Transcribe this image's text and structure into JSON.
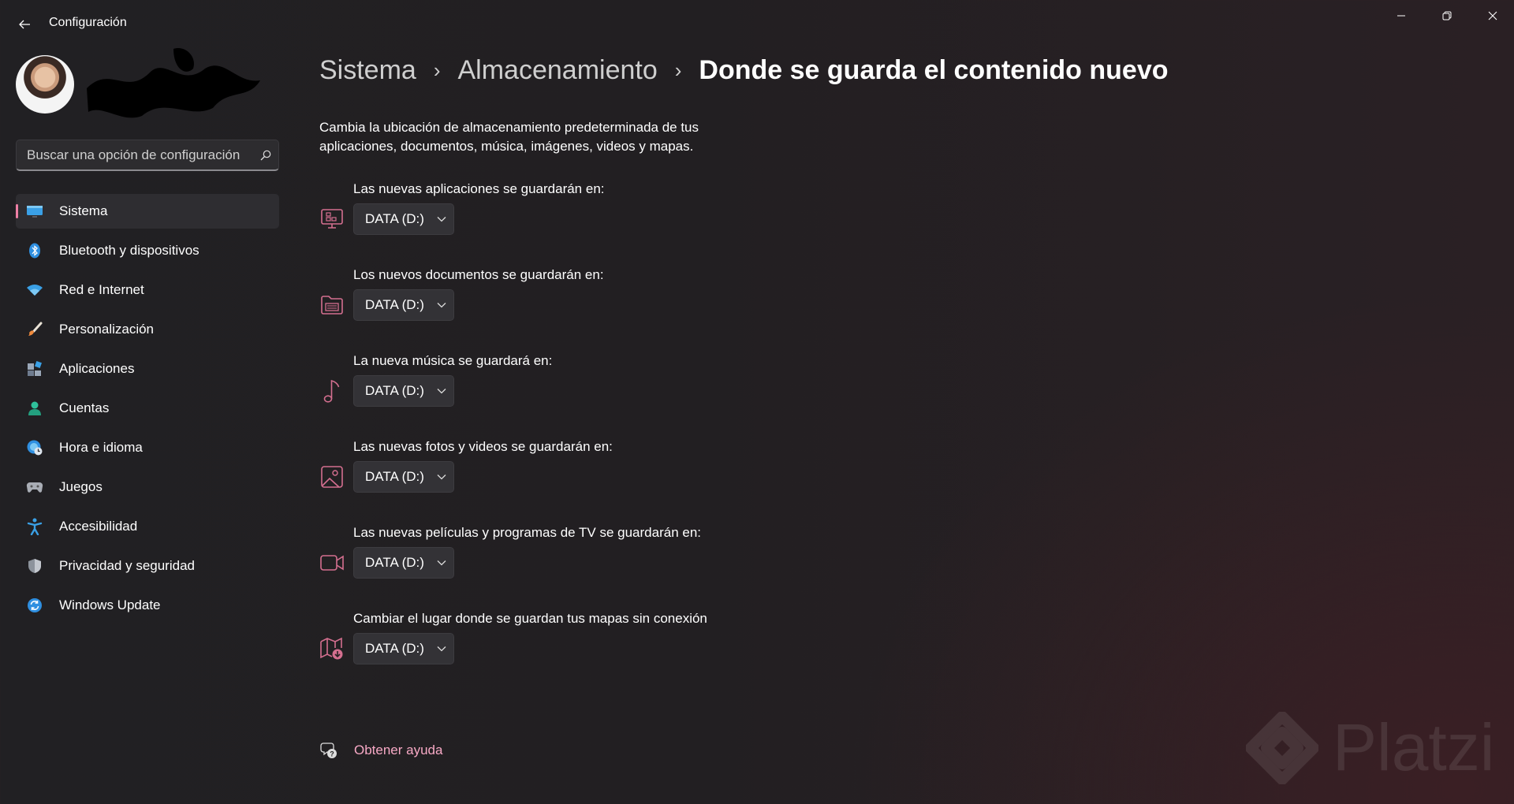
{
  "window": {
    "title": "Configuración",
    "back_icon": "back-arrow-icon",
    "controls": [
      "minimize-icon",
      "maximize-icon",
      "close-icon"
    ]
  },
  "search": {
    "placeholder": "Buscar una opción de configuración",
    "icon": "search-icon"
  },
  "sidebar": {
    "items": [
      {
        "label": "Sistema",
        "icon": "monitor-icon",
        "active": true
      },
      {
        "label": "Bluetooth y dispositivos",
        "icon": "bluetooth-icon",
        "active": false
      },
      {
        "label": "Red e Internet",
        "icon": "wifi-icon",
        "active": false
      },
      {
        "label": "Personalización",
        "icon": "brush-icon",
        "active": false
      },
      {
        "label": "Aplicaciones",
        "icon": "apps-icon",
        "active": false
      },
      {
        "label": "Cuentas",
        "icon": "person-icon",
        "active": false
      },
      {
        "label": "Hora e idioma",
        "icon": "globe-clock-icon",
        "active": false
      },
      {
        "label": "Juegos",
        "icon": "gamepad-icon",
        "active": false
      },
      {
        "label": "Accesibilidad",
        "icon": "accessibility-icon",
        "active": false
      },
      {
        "label": "Privacidad y seguridad",
        "icon": "shield-icon",
        "active": false
      },
      {
        "label": "Windows Update",
        "icon": "update-icon",
        "active": false
      }
    ]
  },
  "breadcrumb": {
    "items": [
      "Sistema",
      "Almacenamiento"
    ],
    "current": "Donde se guarda el contenido nuevo"
  },
  "description": "Cambia la ubicación de almacenamiento predeterminada de tus aplicaciones, documentos, música, imágenes, videos y mapas.",
  "settings": [
    {
      "label": "Las nuevas aplicaciones se guardarán en:",
      "value": "DATA (D:)",
      "icon": "apps-monitor-icon"
    },
    {
      "label": "Los nuevos documentos se guardarán en:",
      "value": "DATA (D:)",
      "icon": "document-folder-icon"
    },
    {
      "label": "La nueva música se guardará en:",
      "value": "DATA (D:)",
      "icon": "music-note-icon"
    },
    {
      "label": "Las nuevas fotos y videos se guardarán en:",
      "value": "DATA (D:)",
      "icon": "photo-icon"
    },
    {
      "label": "Las nuevas películas y programas de TV se guardarán en:",
      "value": "DATA (D:)",
      "icon": "video-camera-icon"
    },
    {
      "label": "Cambiar el lugar donde se guardan tus mapas sin conexión",
      "value": "DATA (D:)",
      "icon": "map-download-icon"
    }
  ],
  "help": {
    "label": "Obtener ayuda",
    "icon": "help-chat-icon"
  },
  "watermark": {
    "text": "Platzi"
  },
  "colors": {
    "accent": "#ee7fa5",
    "link": "#f7a9c5",
    "icon_tint": "#d46f8f"
  }
}
